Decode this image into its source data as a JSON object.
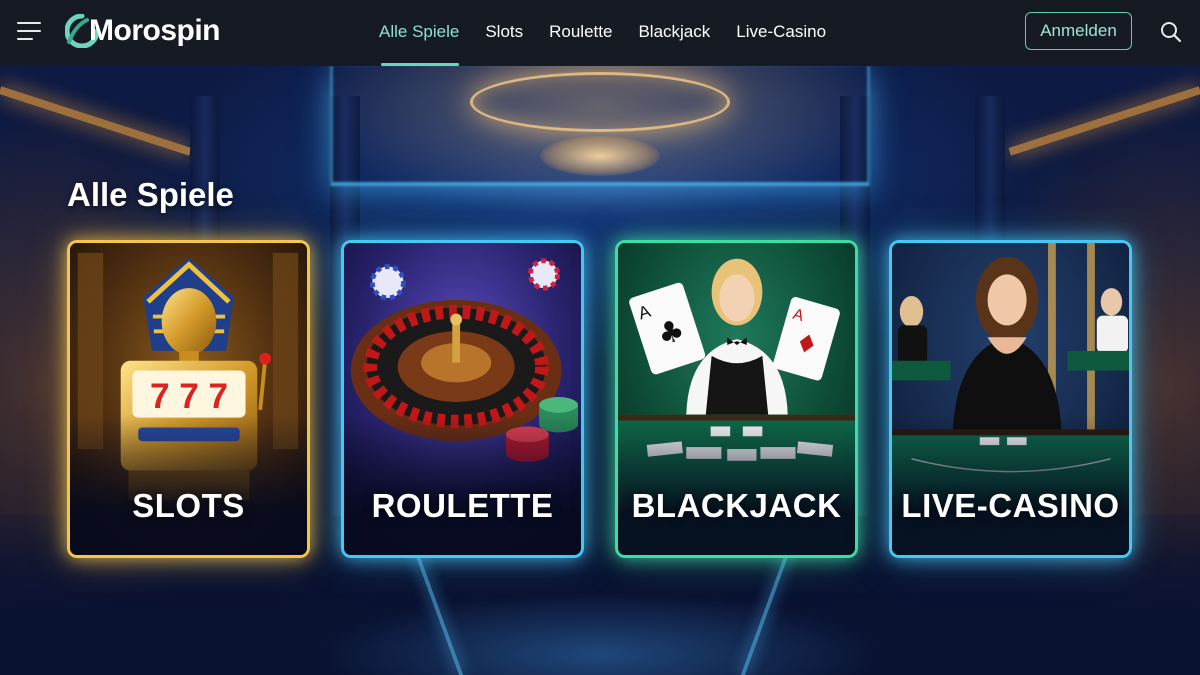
{
  "brand": {
    "name": "Morospin",
    "accent": "#6fd4bd"
  },
  "header": {
    "nav": [
      {
        "label": "Alle Spiele",
        "active": true
      },
      {
        "label": "Slots",
        "active": false
      },
      {
        "label": "Roulette",
        "active": false
      },
      {
        "label": "Blackjack",
        "active": false
      },
      {
        "label": "Live-Casino",
        "active": false
      }
    ],
    "login_label": "Anmelden",
    "icons": {
      "menu": "menu-icon",
      "search": "search-icon"
    }
  },
  "main": {
    "title": "Alle Spiele",
    "cards": [
      {
        "label": "SLOTS",
        "border_color": "#f4c64c"
      },
      {
        "label": "ROULETTE",
        "border_color": "#47c7f4"
      },
      {
        "label": "BLACKJACK",
        "border_color": "#3fdca3"
      },
      {
        "label": "LIVE-CASINO",
        "border_color": "#47c7f4"
      }
    ]
  }
}
